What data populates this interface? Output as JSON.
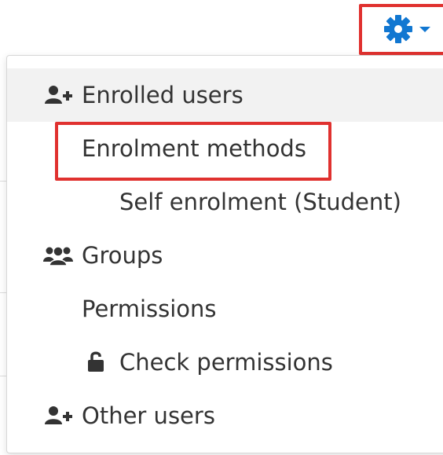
{
  "trigger": {
    "icon": "gear-icon",
    "accent_color": "#1177d1",
    "caret_icon": "caret-down-icon"
  },
  "highlight_color": "#e0312f",
  "menu": {
    "items": [
      {
        "label": "Enrolled users",
        "icon": "add-user-icon",
        "level": 1
      },
      {
        "label": "Enrolment methods",
        "icon": null,
        "level": 1
      },
      {
        "label": "Self enrolment (Student)",
        "icon": null,
        "level": 2
      },
      {
        "label": "Groups",
        "icon": "users-icon",
        "level": 1
      },
      {
        "label": "Permissions",
        "icon": null,
        "level": 1
      },
      {
        "label": "Check permissions",
        "icon": "unlock-icon",
        "level": 2
      },
      {
        "label": "Other users",
        "icon": "add-user-icon",
        "level": 1
      }
    ]
  }
}
